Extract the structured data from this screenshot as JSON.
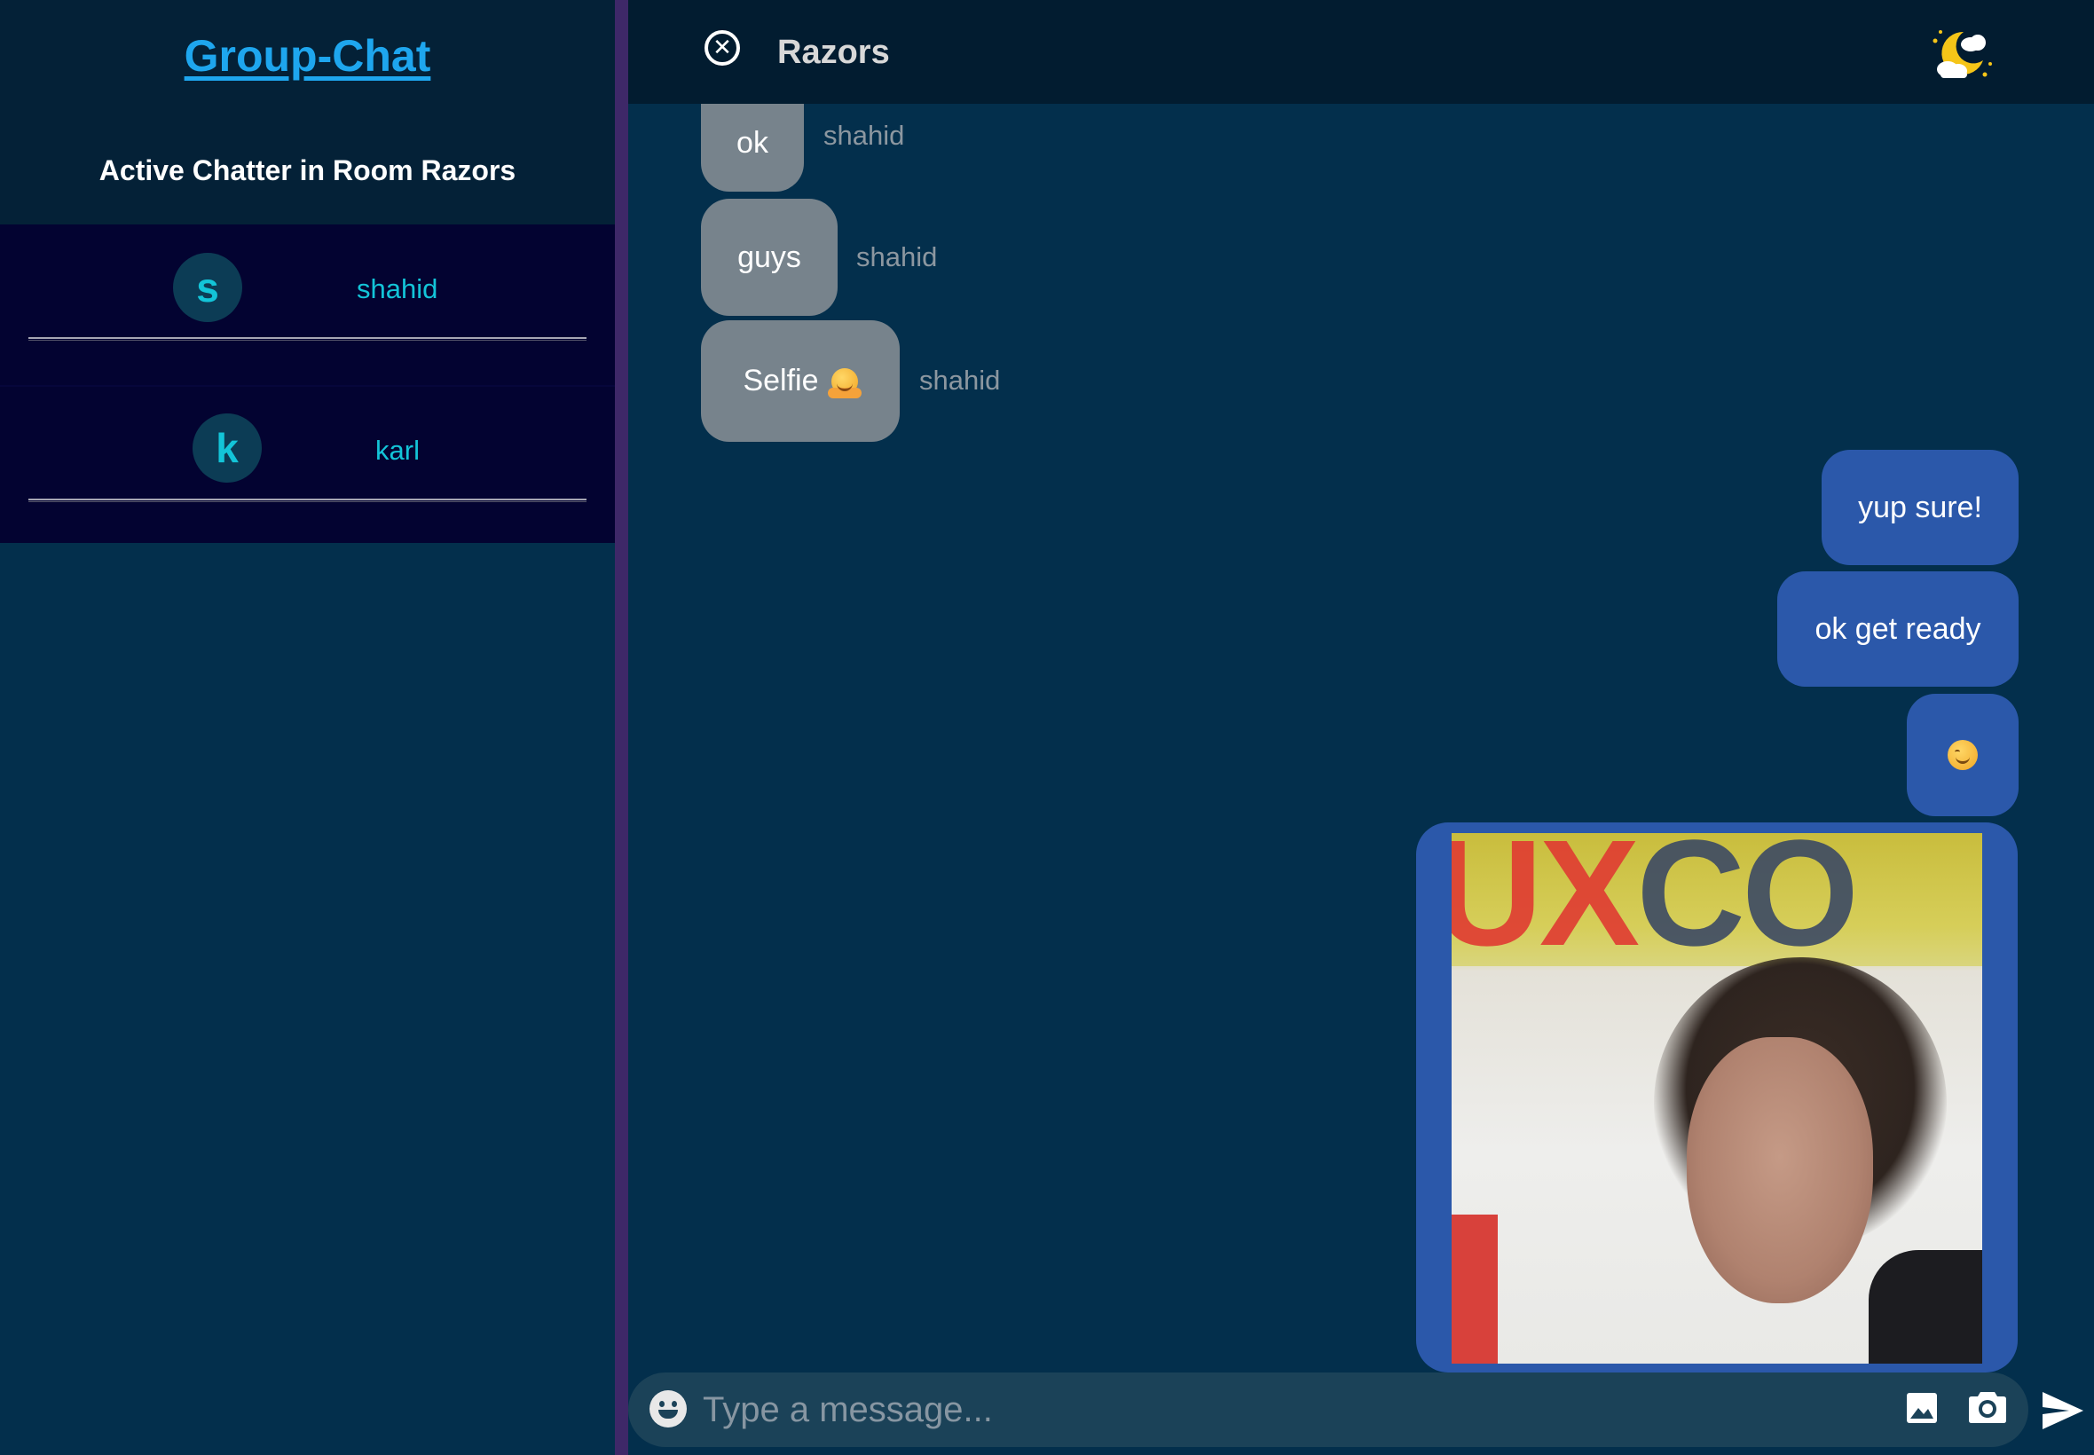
{
  "app": {
    "title": "Group-Chat",
    "accent_color": "#1ea6ee"
  },
  "sidebar": {
    "heading": "Active Chatter in Room Razors",
    "chatters": [
      {
        "initial": "s",
        "name": "shahid"
      },
      {
        "initial": "k",
        "name": "karl"
      }
    ]
  },
  "chat": {
    "room_name": "Razors",
    "close_icon": "close-circle-icon",
    "theme_icon": "moon-cloud-stars-icon",
    "messages": [
      {
        "direction": "incoming",
        "text": "ok",
        "sender": "shahid"
      },
      {
        "direction": "incoming",
        "text": "guys",
        "sender": "shahid"
      },
      {
        "direction": "incoming",
        "text": "Selfie",
        "emoji": "hugging-face-emoji",
        "sender": "shahid"
      },
      {
        "direction": "outgoing",
        "text": "yup sure!"
      },
      {
        "direction": "outgoing",
        "text": "ok get ready"
      },
      {
        "direction": "outgoing",
        "emoji": "smiling-face-emoji"
      },
      {
        "direction": "outgoing",
        "type": "image",
        "description_icon": "photo-message"
      }
    ],
    "colors": {
      "incoming_bubble": "#77838c",
      "outgoing_bubble": "#2b58aa",
      "chatter_name": "#13c4d8"
    }
  },
  "composer": {
    "placeholder": "Type a message...",
    "emoji_icon": "emoji-picker-icon",
    "image_icon": "image-upload-icon",
    "camera_icon": "camera-icon",
    "send_icon": "send-icon"
  }
}
